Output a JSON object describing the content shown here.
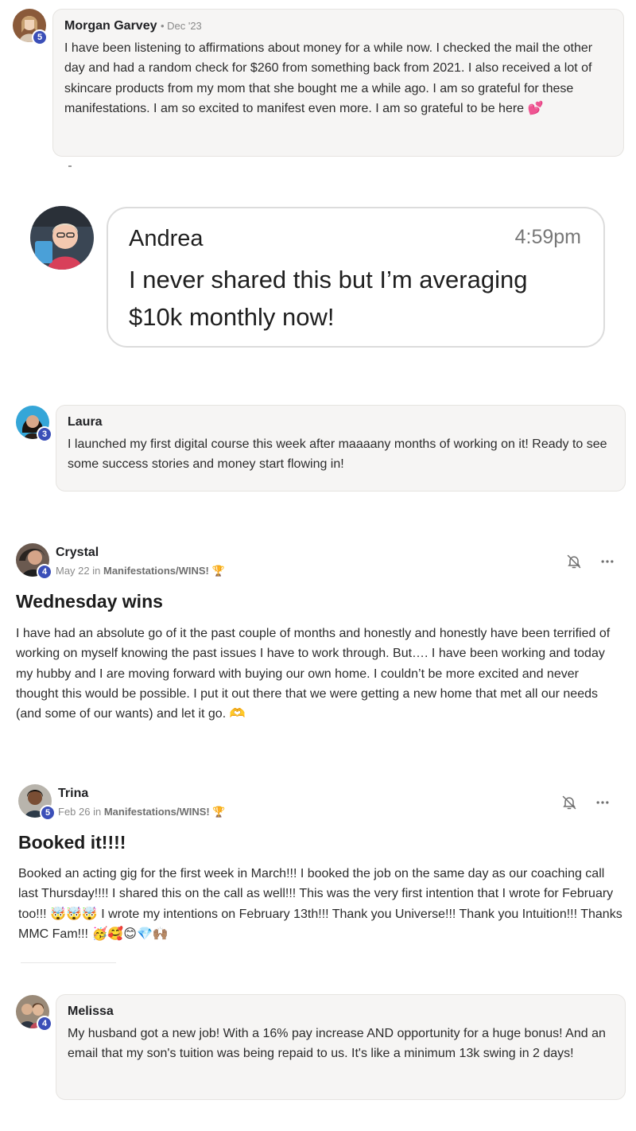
{
  "comments": {
    "morgan": {
      "name": "Morgan Garvey",
      "date": "• Dec '23",
      "level": "5",
      "text": "I have been listening to affirmations about money for a while now. I checked the mail the other day and had a random check for $260 from something back from 2021. I also received a lot of skincare products from my mom that she bought me a while ago. I am so grateful for these manifestations. I am so excited to manifest even more. I am so grateful to be here 💕"
    },
    "laura": {
      "name": "Laura",
      "level": "3",
      "text": "I launched my first digital course this week after maaaany months of working on it! Ready to see some success stories and money start flowing in!"
    },
    "melissa": {
      "name": "Melissa",
      "level": "4",
      "text": "My husband got a new job! With a 16% pay increase AND opportunity for a huge bonus! And an email that my son's tuition was being repaid to us. It's like a minimum 13k swing in 2 days!"
    }
  },
  "message": {
    "name": "Andrea",
    "time": "4:59pm",
    "text": "I never shared this but I’m averaging $10k monthly now!"
  },
  "posts": {
    "crystal": {
      "name": "Crystal",
      "level": "4",
      "date": "May 22 in ",
      "category": "Manifestations/WINS! 🏆",
      "title": "Wednesday wins",
      "body": "I have had an absolute go of it the past couple of months and honestly and honestly have been terrified of working on myself knowing the past issues I have to work through. But…. I have been working and today my hubby and I are moving forward with buying our own home. I couldn’t be more excited and never thought this would be possible. I put it out there that we were getting a new home that met all our needs (and some of our wants) and let it go. 🫶"
    },
    "trina": {
      "name": "Trina",
      "level": "5",
      "date": "Feb 26 in ",
      "category": "Manifestations/WINS! 🏆",
      "title": "Booked it!!!!",
      "body": "Booked an acting gig for the first week in March!!! I booked the job on the same day as our coaching call last Thursday!!!! I shared this on the call as well!!! This was the very first intention that I wrote for February too!!! 🤯🤯🤯 I wrote my intentions on February 13th!!! Thank you Universe!!! Thank you Intuition!!! Thanks MMC Fam!!! 🥳🥰😊💎🙌🏽"
    }
  },
  "icons": {
    "bell": "bell-off-icon",
    "more": "more-horizontal-icon"
  },
  "colors": {
    "level_badge": "#3b4fb8",
    "bubble_bg": "#f6f5f4"
  }
}
